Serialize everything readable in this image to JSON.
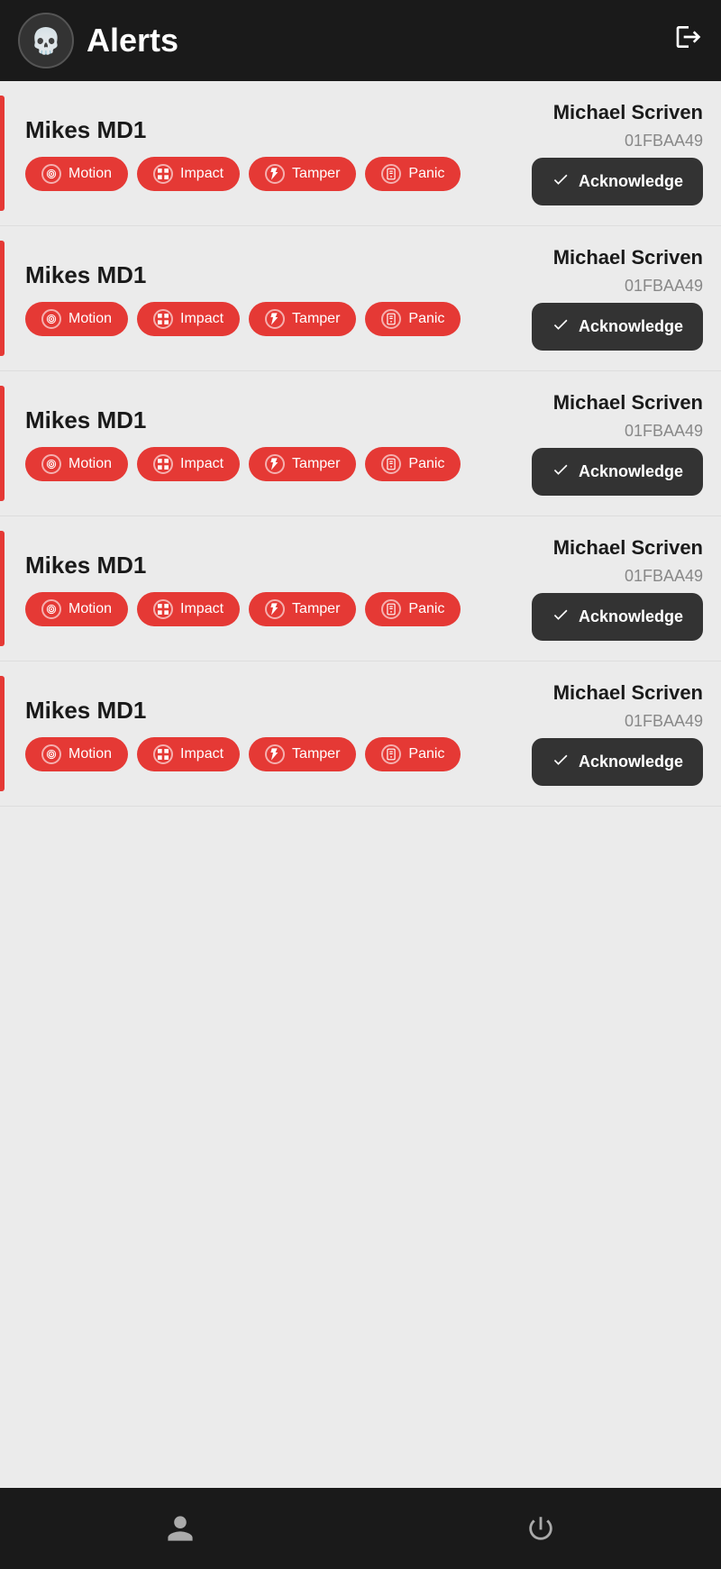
{
  "header": {
    "title": "Alerts",
    "logout_label": "→"
  },
  "alerts": [
    {
      "device_name": "Mikes MD1",
      "user_name": "Michael Scriven",
      "device_id": "01FBAA49",
      "tags": [
        "Motion",
        "Impact",
        "Tamper",
        "Panic"
      ],
      "acknowledge_label": "Acknowledge"
    },
    {
      "device_name": "Mikes MD1",
      "user_name": "Michael Scriven",
      "device_id": "01FBAA49",
      "tags": [
        "Motion",
        "Impact",
        "Tamper",
        "Panic"
      ],
      "acknowledge_label": "Acknowledge"
    },
    {
      "device_name": "Mikes MD1",
      "user_name": "Michael Scriven",
      "device_id": "01FBAA49",
      "tags": [
        "Motion",
        "Impact",
        "Tamper",
        "Panic"
      ],
      "acknowledge_label": "Acknowledge"
    },
    {
      "device_name": "Mikes MD1",
      "user_name": "Michael Scriven",
      "device_id": "01FBAA49",
      "tags": [
        "Motion",
        "Impact",
        "Tamper",
        "Panic"
      ],
      "acknowledge_label": "Acknowledge"
    },
    {
      "device_name": "Mikes MD1",
      "user_name": "Michael Scriven",
      "device_id": "01FBAA49",
      "tags": [
        "Motion",
        "Impact",
        "Tamper",
        "Panic"
      ],
      "acknowledge_label": "Acknowledge"
    }
  ],
  "tag_icons": {
    "Motion": "◎",
    "Impact": "▦",
    "Tamper": "⚡",
    "Panic": "📱"
  },
  "bottom_nav": {
    "profile_icon": "👤",
    "power_icon": "⏻"
  }
}
